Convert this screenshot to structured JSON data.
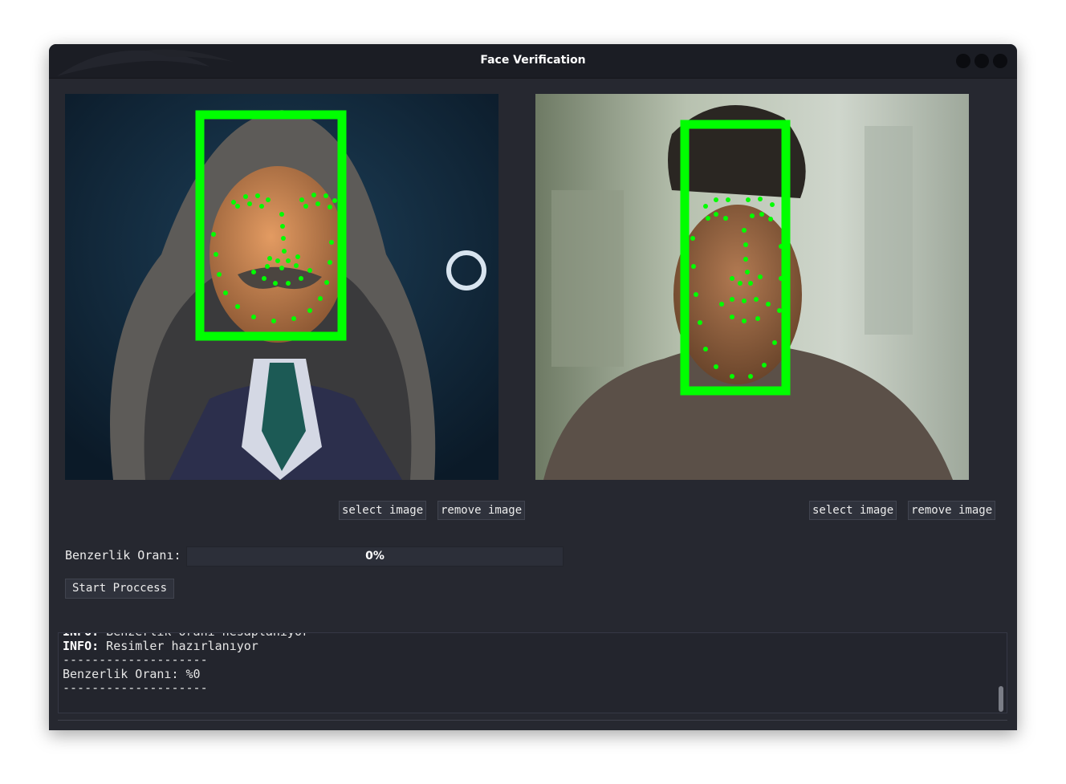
{
  "window": {
    "title": "Face Verification"
  },
  "left_panel": {
    "select_label": "select image",
    "remove_label": "remove image"
  },
  "right_panel": {
    "select_label": "select image",
    "remove_label": "remove image"
  },
  "similarity": {
    "label": "Benzerlik Oranı:",
    "progress_text": "0%",
    "progress_fraction": 0
  },
  "start_button": {
    "label": "Start Proccess"
  },
  "console": {
    "lines": [
      {
        "prefix": "INFO:",
        "text": " Benzerlik oranı hesaplanıyor"
      },
      {
        "prefix": "INFO:",
        "text": " Resimler hazırlanıyor"
      },
      {
        "prefix": "",
        "text": "--------------------"
      },
      {
        "prefix": "",
        "text": "Benzerlik Oranı: %0"
      },
      {
        "prefix": "",
        "text": "--------------------"
      }
    ]
  },
  "colors": {
    "detection_box": "#00ff00",
    "window_bg": "#262830",
    "titlebar_bg": "#1b1d24"
  }
}
